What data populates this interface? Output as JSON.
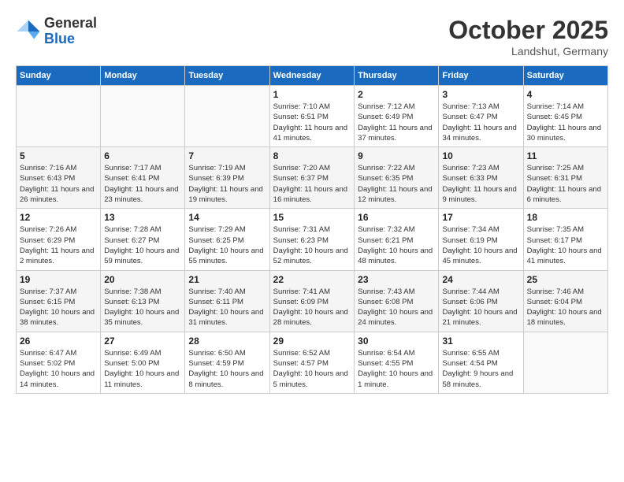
{
  "header": {
    "logo": {
      "general": "General",
      "blue": "Blue"
    },
    "title": "October 2025",
    "location": "Landshut, Germany"
  },
  "calendar": {
    "days_of_week": [
      "Sunday",
      "Monday",
      "Tuesday",
      "Wednesday",
      "Thursday",
      "Friday",
      "Saturday"
    ],
    "weeks": [
      [
        {
          "day": "",
          "info": ""
        },
        {
          "day": "",
          "info": ""
        },
        {
          "day": "",
          "info": ""
        },
        {
          "day": "1",
          "info": "Sunrise: 7:10 AM\nSunset: 6:51 PM\nDaylight: 11 hours and 41 minutes."
        },
        {
          "day": "2",
          "info": "Sunrise: 7:12 AM\nSunset: 6:49 PM\nDaylight: 11 hours and 37 minutes."
        },
        {
          "day": "3",
          "info": "Sunrise: 7:13 AM\nSunset: 6:47 PM\nDaylight: 11 hours and 34 minutes."
        },
        {
          "day": "4",
          "info": "Sunrise: 7:14 AM\nSunset: 6:45 PM\nDaylight: 11 hours and 30 minutes."
        }
      ],
      [
        {
          "day": "5",
          "info": "Sunrise: 7:16 AM\nSunset: 6:43 PM\nDaylight: 11 hours and 26 minutes."
        },
        {
          "day": "6",
          "info": "Sunrise: 7:17 AM\nSunset: 6:41 PM\nDaylight: 11 hours and 23 minutes."
        },
        {
          "day": "7",
          "info": "Sunrise: 7:19 AM\nSunset: 6:39 PM\nDaylight: 11 hours and 19 minutes."
        },
        {
          "day": "8",
          "info": "Sunrise: 7:20 AM\nSunset: 6:37 PM\nDaylight: 11 hours and 16 minutes."
        },
        {
          "day": "9",
          "info": "Sunrise: 7:22 AM\nSunset: 6:35 PM\nDaylight: 11 hours and 12 minutes."
        },
        {
          "day": "10",
          "info": "Sunrise: 7:23 AM\nSunset: 6:33 PM\nDaylight: 11 hours and 9 minutes."
        },
        {
          "day": "11",
          "info": "Sunrise: 7:25 AM\nSunset: 6:31 PM\nDaylight: 11 hours and 6 minutes."
        }
      ],
      [
        {
          "day": "12",
          "info": "Sunrise: 7:26 AM\nSunset: 6:29 PM\nDaylight: 11 hours and 2 minutes."
        },
        {
          "day": "13",
          "info": "Sunrise: 7:28 AM\nSunset: 6:27 PM\nDaylight: 10 hours and 59 minutes."
        },
        {
          "day": "14",
          "info": "Sunrise: 7:29 AM\nSunset: 6:25 PM\nDaylight: 10 hours and 55 minutes."
        },
        {
          "day": "15",
          "info": "Sunrise: 7:31 AM\nSunset: 6:23 PM\nDaylight: 10 hours and 52 minutes."
        },
        {
          "day": "16",
          "info": "Sunrise: 7:32 AM\nSunset: 6:21 PM\nDaylight: 10 hours and 48 minutes."
        },
        {
          "day": "17",
          "info": "Sunrise: 7:34 AM\nSunset: 6:19 PM\nDaylight: 10 hours and 45 minutes."
        },
        {
          "day": "18",
          "info": "Sunrise: 7:35 AM\nSunset: 6:17 PM\nDaylight: 10 hours and 41 minutes."
        }
      ],
      [
        {
          "day": "19",
          "info": "Sunrise: 7:37 AM\nSunset: 6:15 PM\nDaylight: 10 hours and 38 minutes."
        },
        {
          "day": "20",
          "info": "Sunrise: 7:38 AM\nSunset: 6:13 PM\nDaylight: 10 hours and 35 minutes."
        },
        {
          "day": "21",
          "info": "Sunrise: 7:40 AM\nSunset: 6:11 PM\nDaylight: 10 hours and 31 minutes."
        },
        {
          "day": "22",
          "info": "Sunrise: 7:41 AM\nSunset: 6:09 PM\nDaylight: 10 hours and 28 minutes."
        },
        {
          "day": "23",
          "info": "Sunrise: 7:43 AM\nSunset: 6:08 PM\nDaylight: 10 hours and 24 minutes."
        },
        {
          "day": "24",
          "info": "Sunrise: 7:44 AM\nSunset: 6:06 PM\nDaylight: 10 hours and 21 minutes."
        },
        {
          "day": "25",
          "info": "Sunrise: 7:46 AM\nSunset: 6:04 PM\nDaylight: 10 hours and 18 minutes."
        }
      ],
      [
        {
          "day": "26",
          "info": "Sunrise: 6:47 AM\nSunset: 5:02 PM\nDaylight: 10 hours and 14 minutes."
        },
        {
          "day": "27",
          "info": "Sunrise: 6:49 AM\nSunset: 5:00 PM\nDaylight: 10 hours and 11 minutes."
        },
        {
          "day": "28",
          "info": "Sunrise: 6:50 AM\nSunset: 4:59 PM\nDaylight: 10 hours and 8 minutes."
        },
        {
          "day": "29",
          "info": "Sunrise: 6:52 AM\nSunset: 4:57 PM\nDaylight: 10 hours and 5 minutes."
        },
        {
          "day": "30",
          "info": "Sunrise: 6:54 AM\nSunset: 4:55 PM\nDaylight: 10 hours and 1 minute."
        },
        {
          "day": "31",
          "info": "Sunrise: 6:55 AM\nSunset: 4:54 PM\nDaylight: 9 hours and 58 minutes."
        },
        {
          "day": "",
          "info": ""
        }
      ]
    ]
  }
}
